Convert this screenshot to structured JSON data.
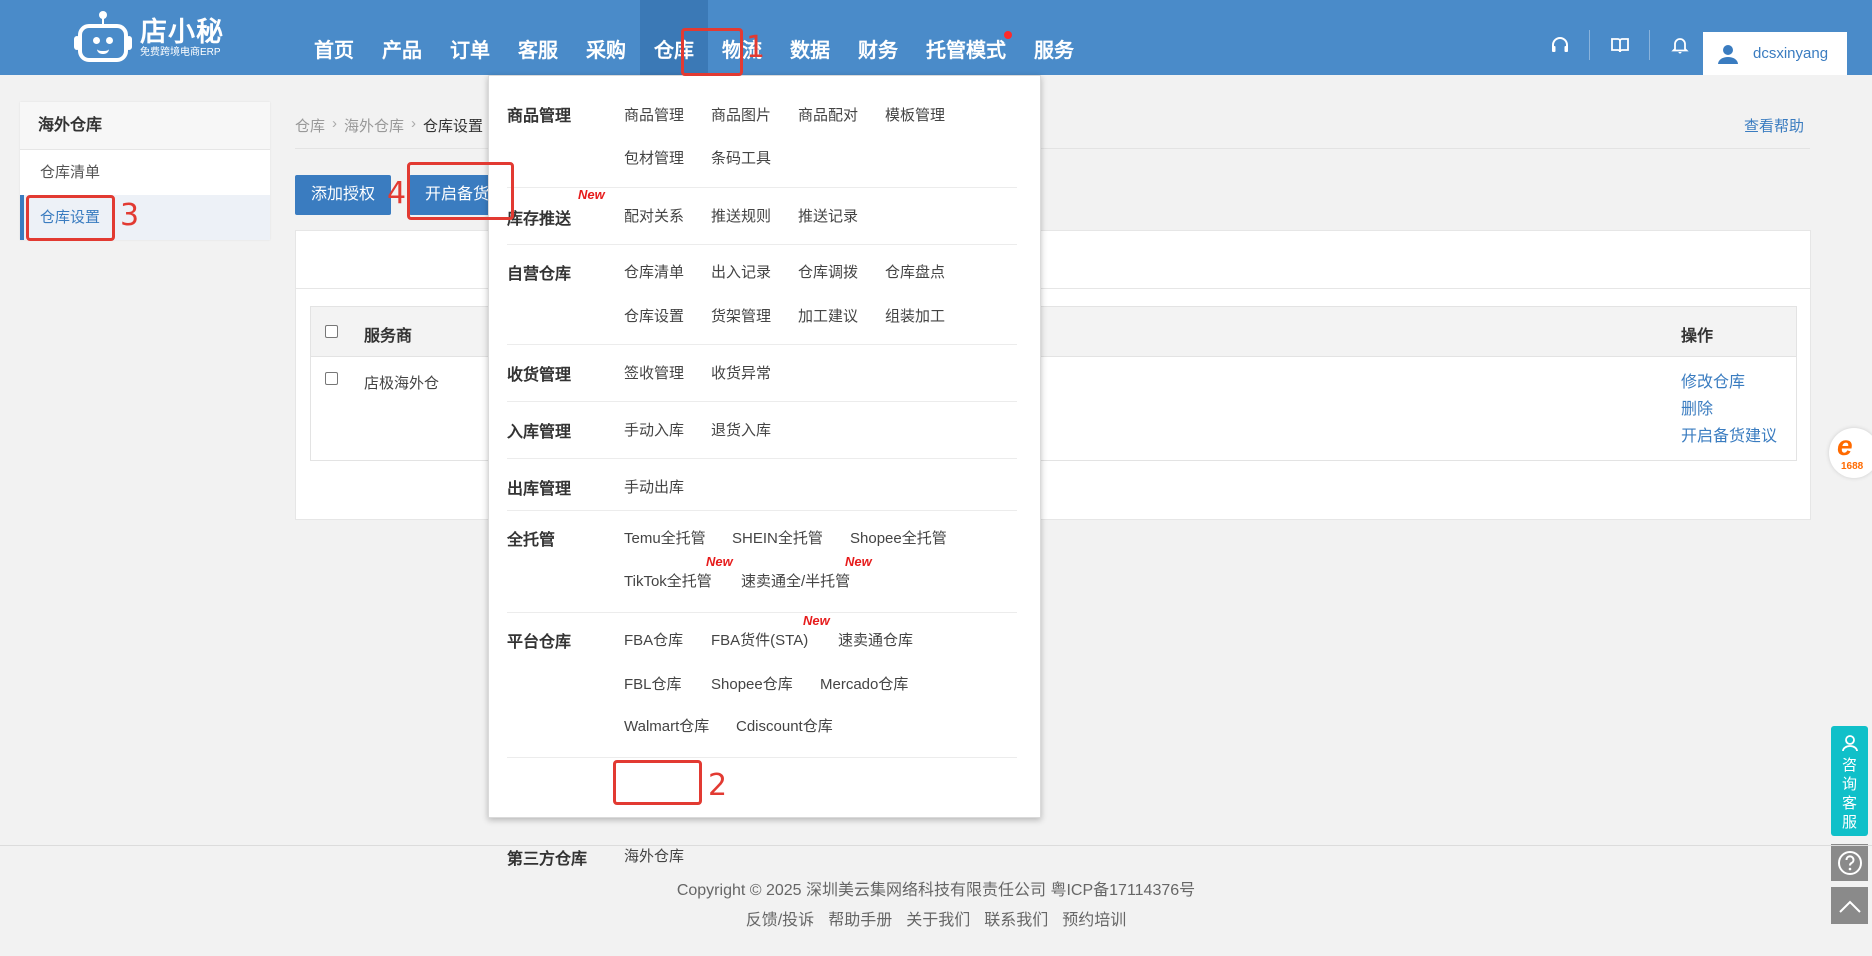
{
  "brand": {
    "name": "店小秘",
    "tagline": "免费跨境电商ERP"
  },
  "nav": [
    {
      "label": "首页"
    },
    {
      "label": "产品"
    },
    {
      "label": "订单"
    },
    {
      "label": "客服"
    },
    {
      "label": "采购"
    },
    {
      "label": "仓库"
    },
    {
      "label": "物流"
    },
    {
      "label": "数据"
    },
    {
      "label": "财务"
    },
    {
      "label": "托管模式"
    },
    {
      "label": "服务"
    }
  ],
  "user": {
    "name": "dcsxinyang"
  },
  "sidebar": {
    "title": "海外仓库",
    "items": [
      {
        "label": "仓库清单"
      },
      {
        "label": "仓库设置"
      }
    ]
  },
  "breadcrumb": {
    "items": [
      "仓库",
      "海外仓库",
      "仓库设置"
    ]
  },
  "help": "查看帮助",
  "buttons": {
    "add_auth": "添加授权",
    "enable_stock": "开启备货"
  },
  "table": {
    "headers": {
      "provider": "服务商",
      "ops": "操作"
    },
    "rows": [
      {
        "provider": "店极海外仓",
        "ops": [
          "修改仓库",
          "删除",
          "开启备货建议"
        ]
      }
    ]
  },
  "menu": {
    "new_label": "New",
    "sections": [
      {
        "title": "商品管理",
        "links": [
          "商品管理",
          "商品图片",
          "商品配对",
          "模板管理",
          "包材管理",
          "条码工具"
        ]
      },
      {
        "title": "库存推送",
        "links": [
          "配对关系",
          "推送规则",
          "推送记录"
        ]
      },
      {
        "title": "自营仓库",
        "links": [
          "仓库清单",
          "出入记录",
          "仓库调拨",
          "仓库盘点",
          "仓库设置",
          "货架管理",
          "加工建议",
          "组装加工"
        ]
      },
      {
        "title": "收货管理",
        "links": [
          "签收管理",
          "收货异常"
        ]
      },
      {
        "title": "入库管理",
        "links": [
          "手动入库",
          "退货入库"
        ]
      },
      {
        "title": "出库管理",
        "links": [
          "手动出库"
        ]
      },
      {
        "title": "全托管",
        "links": [
          "Temu全托管",
          "SHEIN全托管",
          "Shopee全托管",
          "TikTok全托管",
          "速卖通全/半托管"
        ]
      },
      {
        "title": "平台仓库",
        "links": [
          "FBA仓库",
          "FBA货件(STA)",
          "速卖通仓库",
          "FBL仓库",
          "Shopee仓库",
          "Mercado仓库",
          "Walmart仓库",
          "Cdiscount仓库"
        ]
      },
      {
        "title": "第三方仓库",
        "links": [
          "海外仓库"
        ]
      }
    ]
  },
  "annotations": [
    "1",
    "2",
    "3",
    "4"
  ],
  "float": {
    "ali_symbol": "e",
    "ali_number": "1688",
    "consult": "咨询客服"
  },
  "footer": {
    "copyright": "Copyright © 2025 深圳美云集网络科技有限责任公司  粤ICP备17114376号",
    "links": [
      "反馈/投诉",
      "帮助手册",
      "关于我们",
      "联系我们",
      "预约培训"
    ]
  },
  "colors": {
    "primary": "#4a8bc9",
    "accent": "#3a7cc0",
    "annotation": "#e23a32",
    "new": "#e61c1c",
    "consult": "#10c0c9"
  }
}
